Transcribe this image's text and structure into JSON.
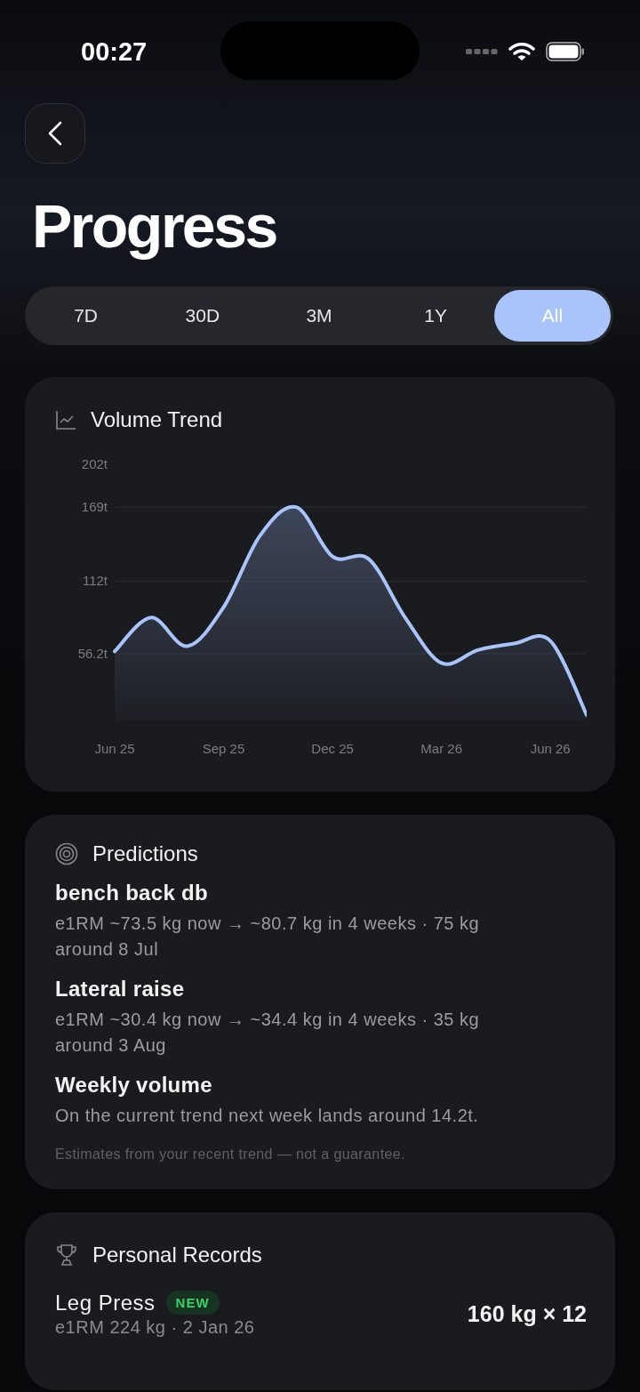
{
  "status_bar": {
    "time": "00:27"
  },
  "title": "Progress",
  "tabs": [
    {
      "label": "7D",
      "selected": false
    },
    {
      "label": "30D",
      "selected": false
    },
    {
      "label": "3M",
      "selected": false
    },
    {
      "label": "1Y",
      "selected": false
    },
    {
      "label": "All",
      "selected": true
    }
  ],
  "volume_card": {
    "title": "Volume Trend",
    "chart_data": {
      "type": "area",
      "categories": [
        "Jun 25",
        null,
        null,
        "Sep 25",
        null,
        null,
        "Dec 25",
        null,
        null,
        "Mar 26",
        null,
        null,
        "Jun 26",
        null
      ],
      "series": [
        {
          "color": "#a9c3fb",
          "values": [
            58,
            84,
            62,
            92,
            147,
            169,
            131,
            129,
            84,
            49,
            59,
            64,
            66,
            9
          ]
        }
      ],
      "ylim": [
        0,
        202
      ],
      "grid": true,
      "yticks": [
        {
          "value": 56.2,
          "label": "56.2t"
        },
        {
          "value": 112,
          "label": "112t"
        },
        {
          "value": 169,
          "label": "169t"
        },
        {
          "value": 202,
          "label": "202t"
        }
      ]
    }
  },
  "predictions": {
    "title": "Predictions",
    "items": [
      {
        "name": "bench back db",
        "detail": "e1RM ~73.5 kg now → ~80.7 kg in 4 weeks · 75 kg around 8 Jul"
      },
      {
        "name": "Lateral raise",
        "detail": "e1RM ~30.4 kg now → ~34.4 kg in 4 weeks · 35 kg around 3 Aug"
      },
      {
        "name": "Weekly volume",
        "detail": "On the current trend next week lands around 14.2t."
      }
    ],
    "note": "Estimates from your recent trend — not a guarantee."
  },
  "records": {
    "title": "Personal Records",
    "items": [
      {
        "name": "Leg Press",
        "badge": "NEW",
        "detail": "e1RM 224 kg · 2 Jan 26",
        "value": "160 kg × 12"
      }
    ]
  }
}
